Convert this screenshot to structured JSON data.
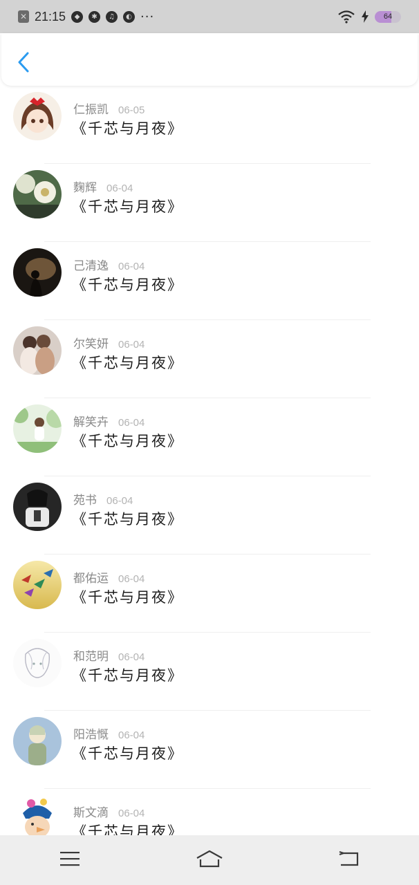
{
  "status_bar": {
    "time": "21:15",
    "battery_level": "64",
    "battery_fraction": 0.64,
    "icons": [
      "close-box-icon",
      "app-icon-1",
      "app-icon-2",
      "app-icon-3",
      "app-icon-4",
      "more-dots-icon",
      "wifi-icon",
      "charging-bolt-icon",
      "battery-icon"
    ]
  },
  "header": {
    "back_icon": "chevron-left-icon",
    "accent_color": "#2a9bf0"
  },
  "list": {
    "items": [
      {
        "name": "仁振凯",
        "date": "06-05",
        "title": "《千芯与月夜》",
        "avatar": "avatar-1"
      },
      {
        "name": "麴辉",
        "date": "06-04",
        "title": "《千芯与月夜》",
        "avatar": "avatar-2"
      },
      {
        "name": "己清逸",
        "date": "06-04",
        "title": "《千芯与月夜》",
        "avatar": "avatar-3"
      },
      {
        "name": "尔笑妍",
        "date": "06-04",
        "title": "《千芯与月夜》",
        "avatar": "avatar-4"
      },
      {
        "name": "解笑卉",
        "date": "06-04",
        "title": "《千芯与月夜》",
        "avatar": "avatar-5"
      },
      {
        "name": "苑书",
        "date": "06-04",
        "title": "《千芯与月夜》",
        "avatar": "avatar-6"
      },
      {
        "name": "都佑运",
        "date": "06-04",
        "title": "《千芯与月夜》",
        "avatar": "avatar-7"
      },
      {
        "name": "和范明",
        "date": "06-04",
        "title": "《千芯与月夜》",
        "avatar": "avatar-8"
      },
      {
        "name": "阳浩慨",
        "date": "06-04",
        "title": "《千芯与月夜》",
        "avatar": "avatar-9"
      },
      {
        "name": "斯文滴",
        "date": "06-04",
        "title": "《千芯与月夜》",
        "avatar": "avatar-10"
      }
    ]
  },
  "bottom_nav": {
    "items": [
      "menu-icon",
      "home-icon",
      "back-icon"
    ]
  }
}
